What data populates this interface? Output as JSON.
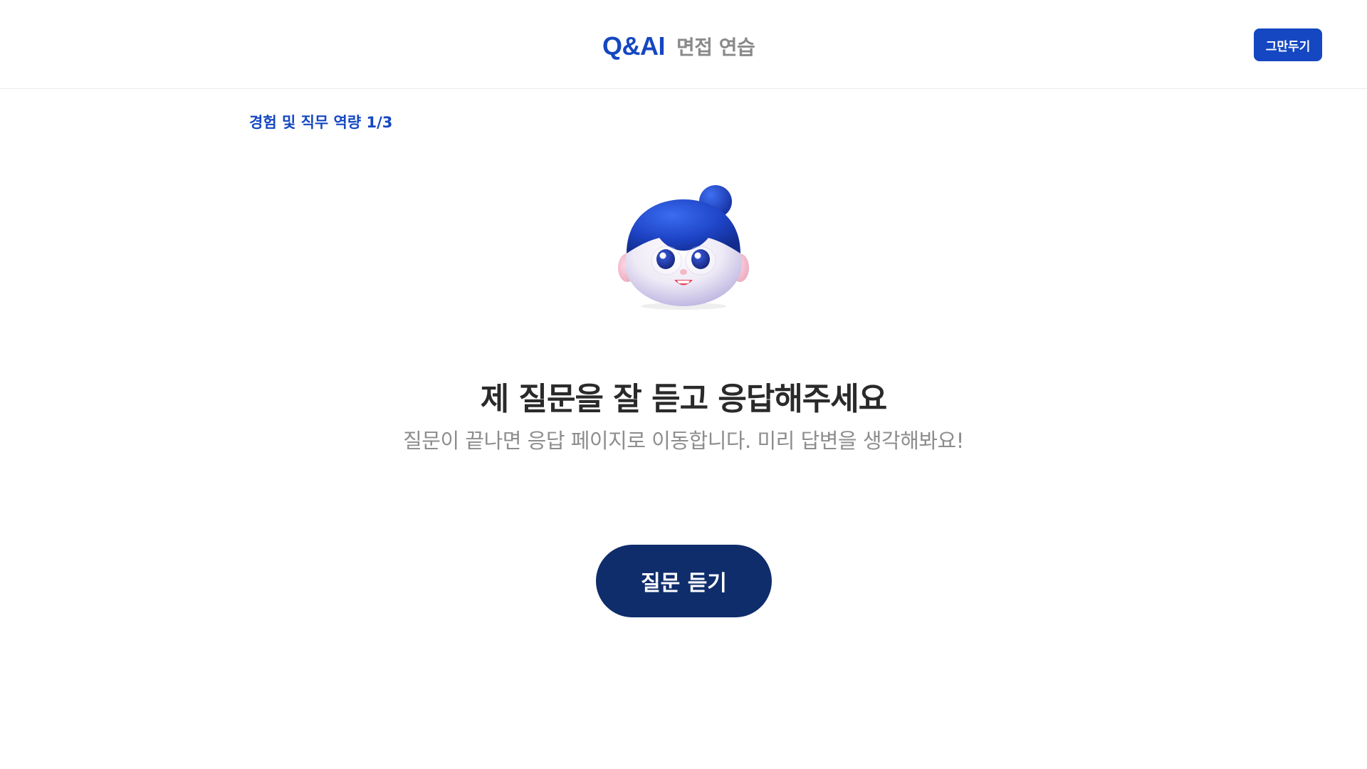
{
  "header": {
    "logo": "Q&AI",
    "subtitle": "면접 연습",
    "quit_label": "그만두기"
  },
  "progress": {
    "label": "경험 및 직무 역량 1/3"
  },
  "avatar": {
    "icon": "interviewer-avatar-icon"
  },
  "main": {
    "title": "제 질문을 잘 듣고 응답해주세요",
    "description": "질문이 끝나면 응답 페이지로 이동합니다. 미리 답변을 생각해봐요!",
    "listen_label": "질문 듣기"
  },
  "colors": {
    "brand": "#1547c2",
    "button_dark": "#0f2d6b",
    "title": "#2a2a2a",
    "muted": "#8d8d8d"
  }
}
